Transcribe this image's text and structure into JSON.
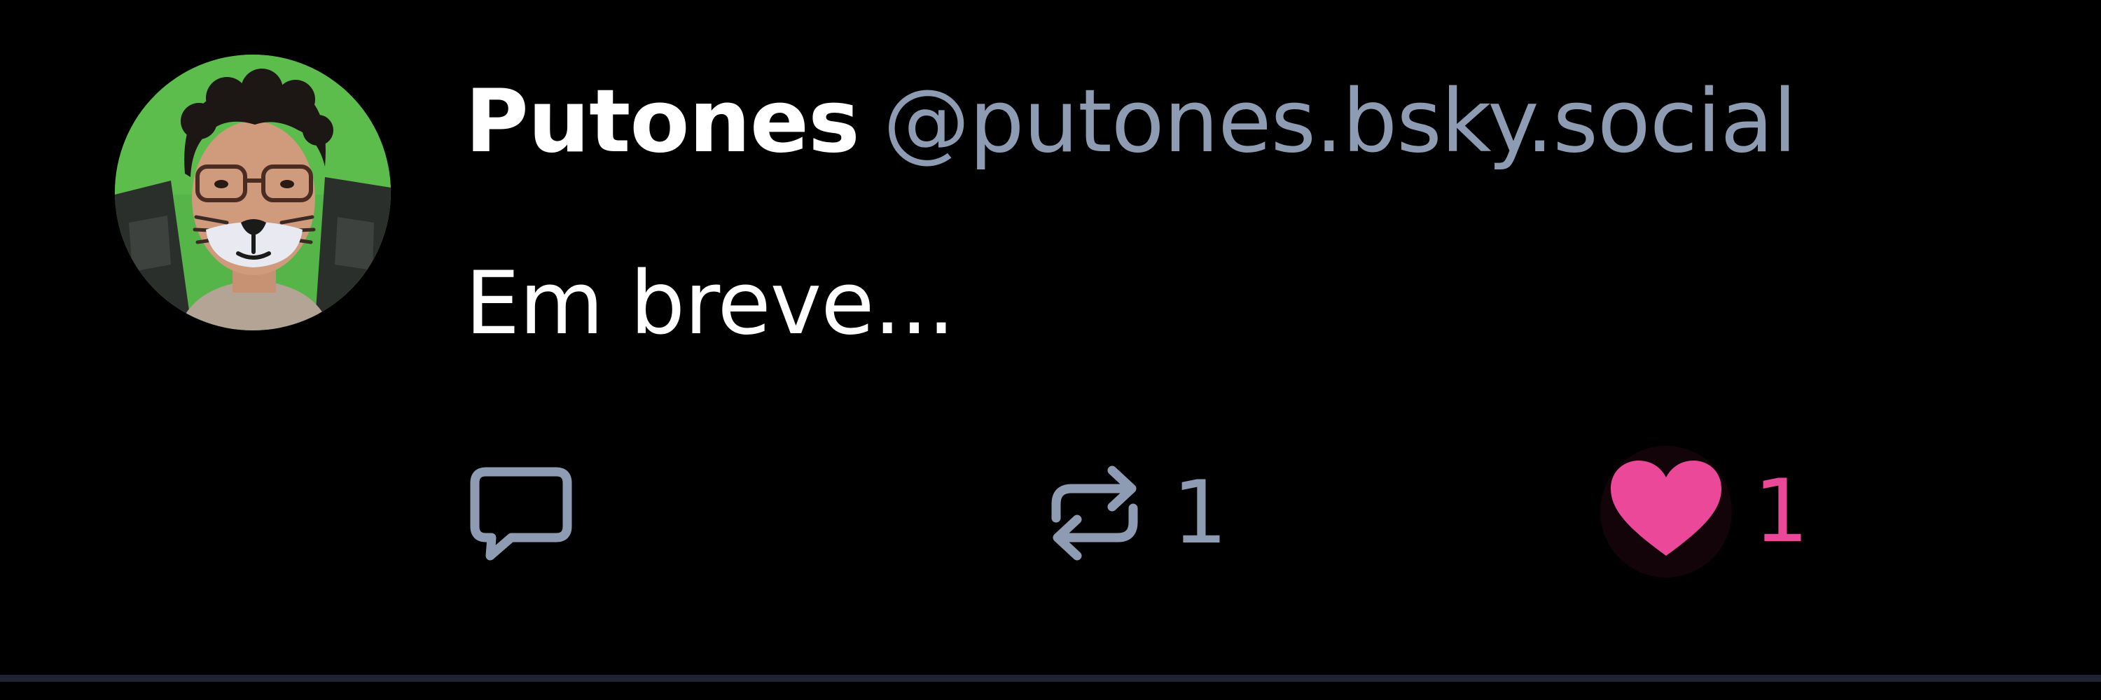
{
  "post": {
    "author": {
      "display_name": "Putones",
      "handle": "@putones.bsky.social"
    },
    "text": "Em breve...",
    "actions": {
      "reply": {
        "icon": "reply-bubble-icon"
      },
      "repost": {
        "icon": "repost-arrows-icon",
        "count": "1"
      },
      "like": {
        "icon": "heart-icon",
        "count": "1",
        "liked": true
      }
    }
  },
  "colors": {
    "background": "#000000",
    "text_primary": "#ffffff",
    "text_secondary": "#8d9cb2",
    "like_active": "#ec4899",
    "divider": "#1e2431"
  }
}
